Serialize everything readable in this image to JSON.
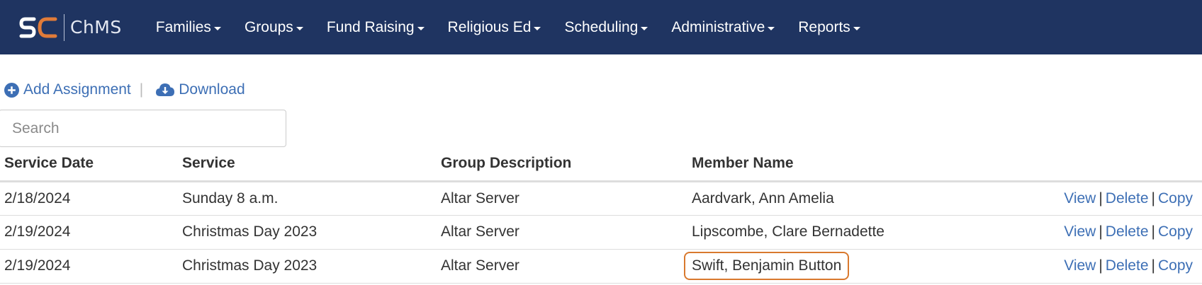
{
  "brand": {
    "logo_text": "SC",
    "name": "ChMS"
  },
  "nav": [
    {
      "label": "Families"
    },
    {
      "label": "Groups"
    },
    {
      "label": "Fund Raising"
    },
    {
      "label": "Religious Ed"
    },
    {
      "label": "Scheduling"
    },
    {
      "label": "Administrative"
    },
    {
      "label": "Reports"
    }
  ],
  "actions": {
    "add_label": "Add Assignment",
    "separator": "|",
    "download_label": "Download"
  },
  "search": {
    "placeholder": "Search",
    "value": ""
  },
  "table": {
    "headers": {
      "date": "Service Date",
      "service": "Service",
      "group": "Group Description",
      "member": "Member Name"
    },
    "rows": [
      {
        "date": "2/18/2024",
        "service": "Sunday 8 a.m.",
        "group": "Altar Server",
        "member": "Aardvark, Ann Amelia",
        "view": "View",
        "delete": "Delete",
        "copy": "Copy",
        "sep": "|"
      },
      {
        "date": "2/19/2024",
        "service": "Christmas Day 2023",
        "group": "Altar Server",
        "member": "Lipscombe, Clare Bernadette",
        "view": "View",
        "delete": "Delete",
        "copy": "Copy",
        "sep": "|"
      },
      {
        "date": "2/19/2024",
        "service": "Christmas Day 2023",
        "group": "Altar Server",
        "member": "Swift, Benjamin Button",
        "view": "View",
        "delete": "Delete",
        "copy": "Copy",
        "sep": "|"
      }
    ]
  },
  "colors": {
    "navbar": "#1f3461",
    "link": "#3d6fb5",
    "highlight_border": "#d9792e"
  },
  "icons": {
    "add": "plus-circle-icon",
    "download": "cloud-download-icon"
  }
}
